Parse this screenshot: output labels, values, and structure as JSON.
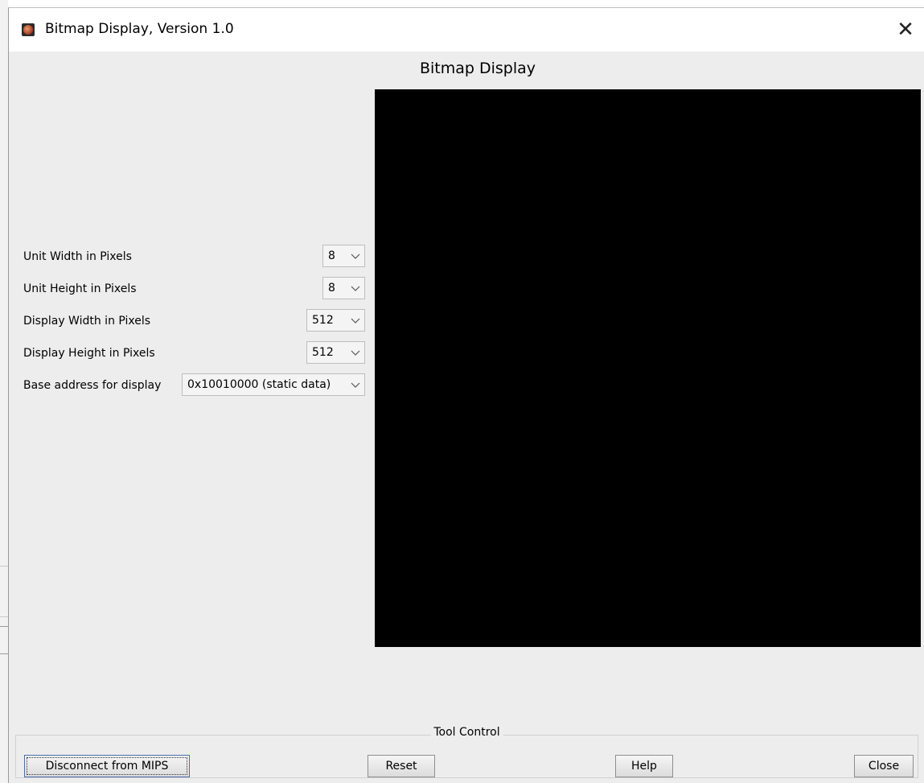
{
  "window": {
    "title": "Bitmap Display, Version 1.0",
    "close_glyph": "✕",
    "icon": "mars-globe-icon"
  },
  "panel": {
    "title": "Bitmap Display",
    "display_color": "#000000"
  },
  "settings": [
    {
      "label": "Unit Width in Pixels",
      "value": "8"
    },
    {
      "label": "Unit Height in Pixels",
      "value": "8"
    },
    {
      "label": "Display Width in Pixels",
      "value": "512"
    },
    {
      "label": "Display Height in Pixels",
      "value": "512"
    },
    {
      "label": "Base address for display",
      "value": "0x10010000 (static data)"
    }
  ],
  "tool_control": {
    "legend": "Tool Control",
    "buttons": {
      "disconnect": "Disconnect from MIPS",
      "reset": "Reset",
      "help": "Help",
      "close": "Close"
    }
  }
}
